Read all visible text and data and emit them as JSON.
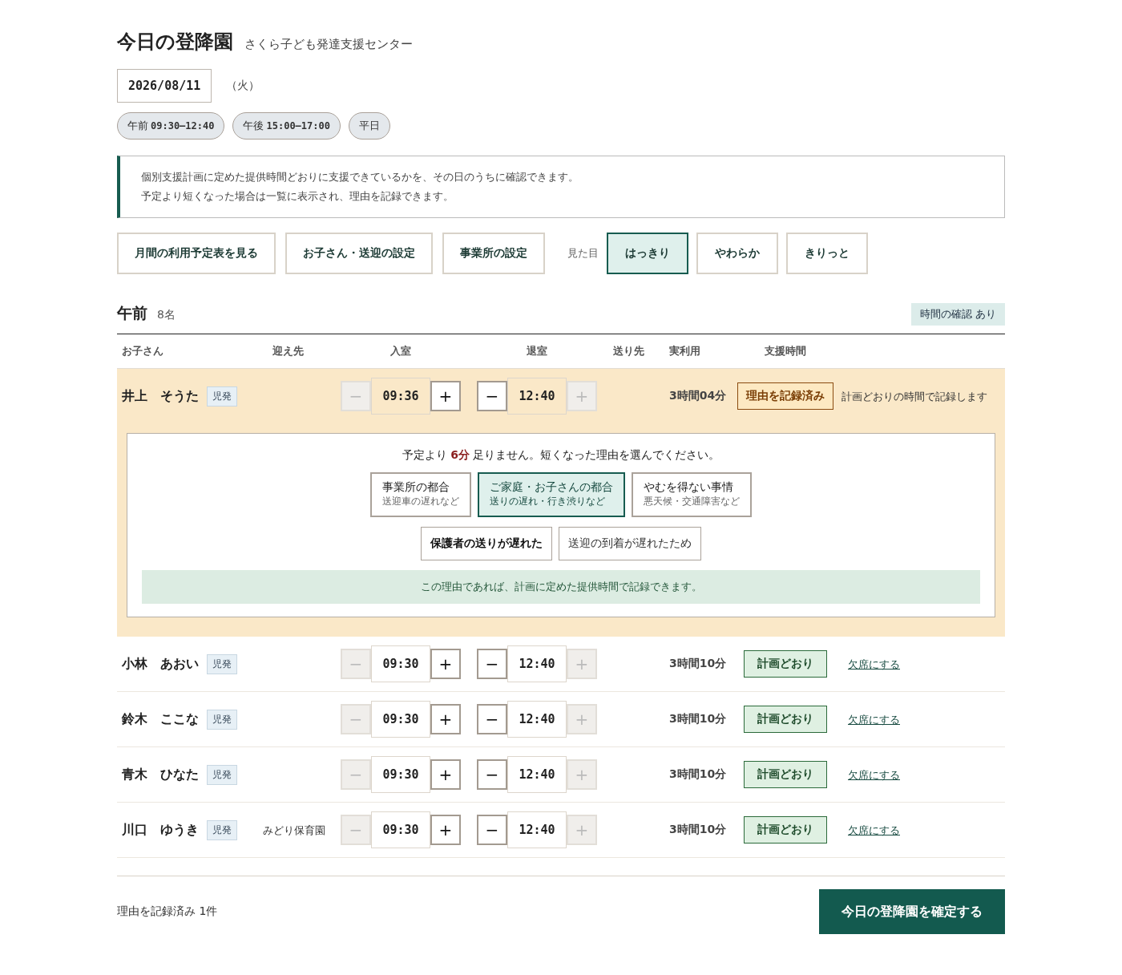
{
  "header": {
    "title": "今日の登降園",
    "facility": "さくら子ども発達支援センター"
  },
  "date": {
    "value": "2026/08/11",
    "weekday": "（火）"
  },
  "chips": [
    {
      "label": "午前",
      "time": "09:30–12:40"
    },
    {
      "label": "午後",
      "time": "15:00–17:00"
    },
    {
      "label": "平日"
    }
  ],
  "notice": [
    "個別支援計画に定めた提供時間どおりに支援できているかを、その日のうちに確認できます。",
    "予定より短くなった場合は一覧に表示され、理由を記録できます。"
  ],
  "actions": [
    "月間の利用予定表を見る",
    "お子さん・送迎の設定",
    "事業所の設定"
  ],
  "theme": {
    "label": "見た目",
    "options": [
      {
        "label": "はっきり",
        "selected": true
      },
      {
        "label": "やわらか",
        "selected": false
      },
      {
        "label": "きりっと",
        "selected": false
      }
    ]
  },
  "session": {
    "title": "午前",
    "count": "8名",
    "badge": "時間の確認 あり",
    "columns": [
      "お子さん",
      "迎え先",
      "入室",
      "退室",
      "送り先",
      "実利用",
      "支援時間"
    ],
    "rows": [
      {
        "name": "井上　そうた",
        "tag": "児発",
        "highlighted": true,
        "in": {
          "minus": {
            "label": "−",
            "disabled": true
          },
          "value": "09:36",
          "plus": {
            "label": "+",
            "disabled": false
          }
        },
        "out": {
          "minus": {
            "label": "−",
            "disabled": false
          },
          "value": "12:40",
          "plus": {
            "label": "+",
            "disabled": true
          }
        },
        "actual": "3時間04分",
        "status": {
          "kind": "recorded",
          "label": "理由を記録済み"
        },
        "note": {
          "kind": "text",
          "label": "計画どおりの時間で記録します"
        },
        "reason": {
          "message": "予定より **6分** 足りません。短くなった理由を選んでください。",
          "options": [
            {
              "title": "事業所の都合",
              "sub": "送迎車の遅れなど",
              "selected": false
            },
            {
              "title": "ご家庭・お子さんの都合",
              "sub": "送りの遅れ・行き渋りなど",
              "selected": true
            },
            {
              "title": "やむを得ない事情",
              "sub": "悪天候・交通障害など",
              "selected": false
            }
          ],
          "details": [
            {
              "label": "保護者の送りが遅れた",
              "selected": true
            },
            {
              "label": "送迎の到着が遅れたため",
              "selected": false
            }
          ],
          "result": "この理由であれば、計画に定めた提供時間で記録できます。"
        }
      },
      {
        "name": "小林　あおい",
        "tag": "児発",
        "highlighted": false,
        "in": {
          "minus": {
            "label": "−",
            "disabled": true
          },
          "value": "09:30",
          "plus": {
            "label": "+",
            "disabled": false
          }
        },
        "out": {
          "minus": {
            "label": "−",
            "disabled": false
          },
          "value": "12:40",
          "plus": {
            "label": "+",
            "disabled": true
          }
        },
        "actual": "3時間10分",
        "status": {
          "kind": "on_plan",
          "label": "計画どおり"
        },
        "note": {
          "kind": "link",
          "label": "欠席にする"
        }
      },
      {
        "name": "鈴木　ここな",
        "tag": "児発",
        "highlighted": false,
        "in": {
          "minus": {
            "label": "−",
            "disabled": true
          },
          "value": "09:30",
          "plus": {
            "label": "+",
            "disabled": false
          }
        },
        "out": {
          "minus": {
            "label": "−",
            "disabled": false
          },
          "value": "12:40",
          "plus": {
            "label": "+",
            "disabled": true
          }
        },
        "actual": "3時間10分",
        "status": {
          "kind": "on_plan",
          "label": "計画どおり"
        },
        "note": {
          "kind": "link",
          "label": "欠席にする"
        }
      },
      {
        "name": "青木　ひなた",
        "tag": "児発",
        "highlighted": false,
        "in": {
          "minus": {
            "label": "−",
            "disabled": true
          },
          "value": "09:30",
          "plus": {
            "label": "+",
            "disabled": false
          }
        },
        "out": {
          "minus": {
            "label": "−",
            "disabled": false
          },
          "value": "12:40",
          "plus": {
            "label": "+",
            "disabled": true
          }
        },
        "actual": "3時間10分",
        "status": {
          "kind": "on_plan",
          "label": "計画どおり"
        },
        "note": {
          "kind": "link",
          "label": "欠席にする"
        }
      },
      {
        "name": "川口　ゆうき",
        "tag": "児発",
        "pickup": "みどり保育園",
        "highlighted": false,
        "in": {
          "minus": {
            "label": "−",
            "disabled": true
          },
          "value": "09:30",
          "plus": {
            "label": "+",
            "disabled": false
          }
        },
        "out": {
          "minus": {
            "label": "−",
            "disabled": false
          },
          "value": "12:40",
          "plus": {
            "label": "+",
            "disabled": true
          }
        },
        "actual": "3時間10分",
        "status": {
          "kind": "on_plan",
          "label": "計画どおり"
        },
        "note": {
          "kind": "link",
          "label": "欠席にする"
        }
      }
    ]
  },
  "footer": {
    "summary": "理由を記録済み 1件",
    "confirm": "今日の登降園を確定する"
  }
}
